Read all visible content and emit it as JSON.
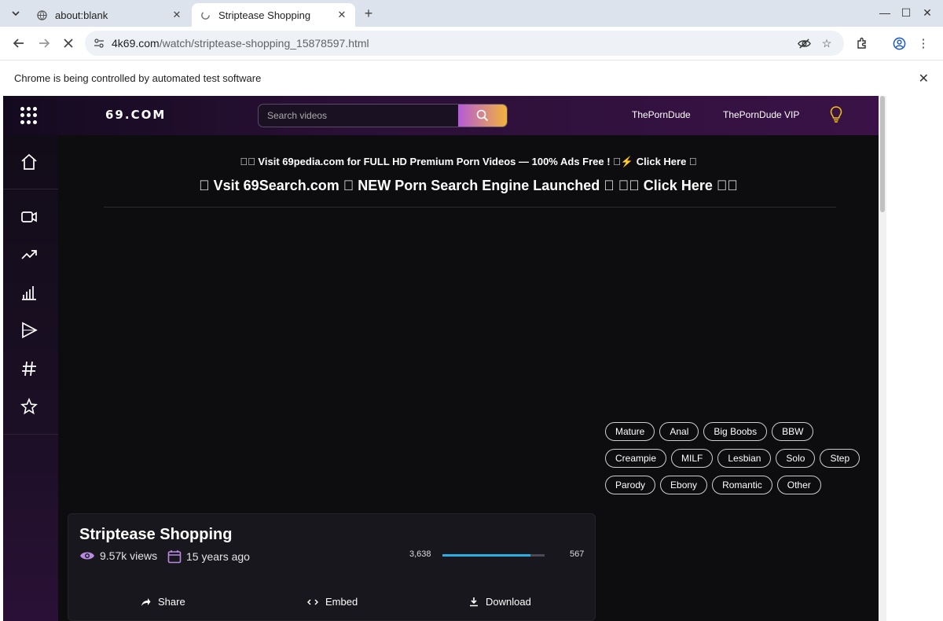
{
  "browser": {
    "tabs": [
      {
        "title": "about:blank",
        "active": false
      },
      {
        "title": "Striptease Shopping",
        "active": true
      }
    ],
    "url_host": "4k69.com",
    "url_path": "/watch/striptease-shopping_15878597.html",
    "infobar_message": "Chrome is being controlled by automated test software"
  },
  "site": {
    "logo": "69.COM",
    "search_placeholder": "Search videos",
    "header_links": [
      "ThePornDude",
      "ThePornDude VIP"
    ],
    "notice_line1": "\u0000\u0000 Visit 69pedia.com for FULL HD Premium Porn Videos — 100% Ads Free ! \u0000⚡ Click Here \u0000",
    "notice_line2": "\u0000 Vsit 69Search.com \u0000 NEW Porn Search Engine Launched \u0000 \u0000\u0000 Click Here \u0000\u0000",
    "sidebar_icons": [
      "home-icon",
      "video-camera-icon",
      "trending-icon",
      "chart-bars-icon",
      "play-icon",
      "hashtag-icon",
      "star-icon"
    ],
    "tags": [
      [
        "Mature",
        "Anal",
        "Big Boobs",
        "BBW"
      ],
      [
        "Creampie",
        "MILF",
        "Lesbian",
        "Solo",
        "Step"
      ],
      [
        "Parody",
        "Ebony",
        "Romantic",
        "Other"
      ]
    ],
    "video": {
      "title": "Striptease Shopping",
      "views": "9.57k views",
      "date": "15 years ago",
      "likes": "3,638",
      "dislikes": "567",
      "like_ratio": 0.865,
      "actions": [
        "Share",
        "Embed",
        "Download"
      ]
    },
    "colors": {
      "accent_gradient_start": "#b45ad8",
      "accent_gradient_end": "#f3b33a",
      "rating_fill": "#28b0e6",
      "bulb": "#f1c40f"
    }
  }
}
